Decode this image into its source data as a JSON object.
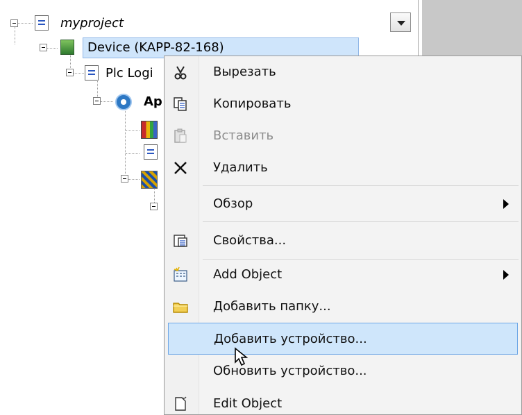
{
  "tree": {
    "project": {
      "label": "myproject",
      "icon": "project-doc-icon"
    },
    "device": {
      "label": "Device (KAPP-82-168)",
      "icon": "device-icon"
    },
    "plc_logic": {
      "label": "Plc Logi",
      "icon": "plc-logic-icon"
    },
    "application": {
      "label": "Ap",
      "icon": "application-gear-icon"
    },
    "child_icons": [
      "library-icon",
      "document-icon",
      "task-config-icon"
    ]
  },
  "context_menu": {
    "items": [
      {
        "label": "Вырезать",
        "icon": "scissors-icon",
        "state": "enabled"
      },
      {
        "label": "Копировать",
        "icon": "copy-icon",
        "state": "enabled"
      },
      {
        "label": "Вставить",
        "icon": "paste-icon",
        "state": "disabled"
      },
      {
        "label": "Удалить",
        "icon": "delete-icon",
        "state": "enabled"
      },
      {
        "label": "Обзор",
        "icon": "",
        "state": "enabled",
        "submenu": true
      },
      {
        "label": "Свойства...",
        "icon": "properties-icon",
        "state": "enabled"
      },
      {
        "label": "Add Object",
        "icon": "add-object-icon",
        "state": "enabled",
        "submenu": true
      },
      {
        "label": "Добавить папку...",
        "icon": "folder-icon",
        "state": "enabled"
      },
      {
        "label": "Добавить устройство...",
        "icon": "",
        "state": "highlighted"
      },
      {
        "label": "Обновить устройство...",
        "icon": "",
        "state": "enabled"
      },
      {
        "label": "Edit Object",
        "icon": "edit-object-icon",
        "state": "enabled"
      }
    ]
  },
  "colors": {
    "selection": "#cfe5fb",
    "highlight": "#cfe6fb",
    "menu_background": "#f3f3f3",
    "disabled_text": "#8c8c8c",
    "side_panel": "#c8c8c8"
  }
}
